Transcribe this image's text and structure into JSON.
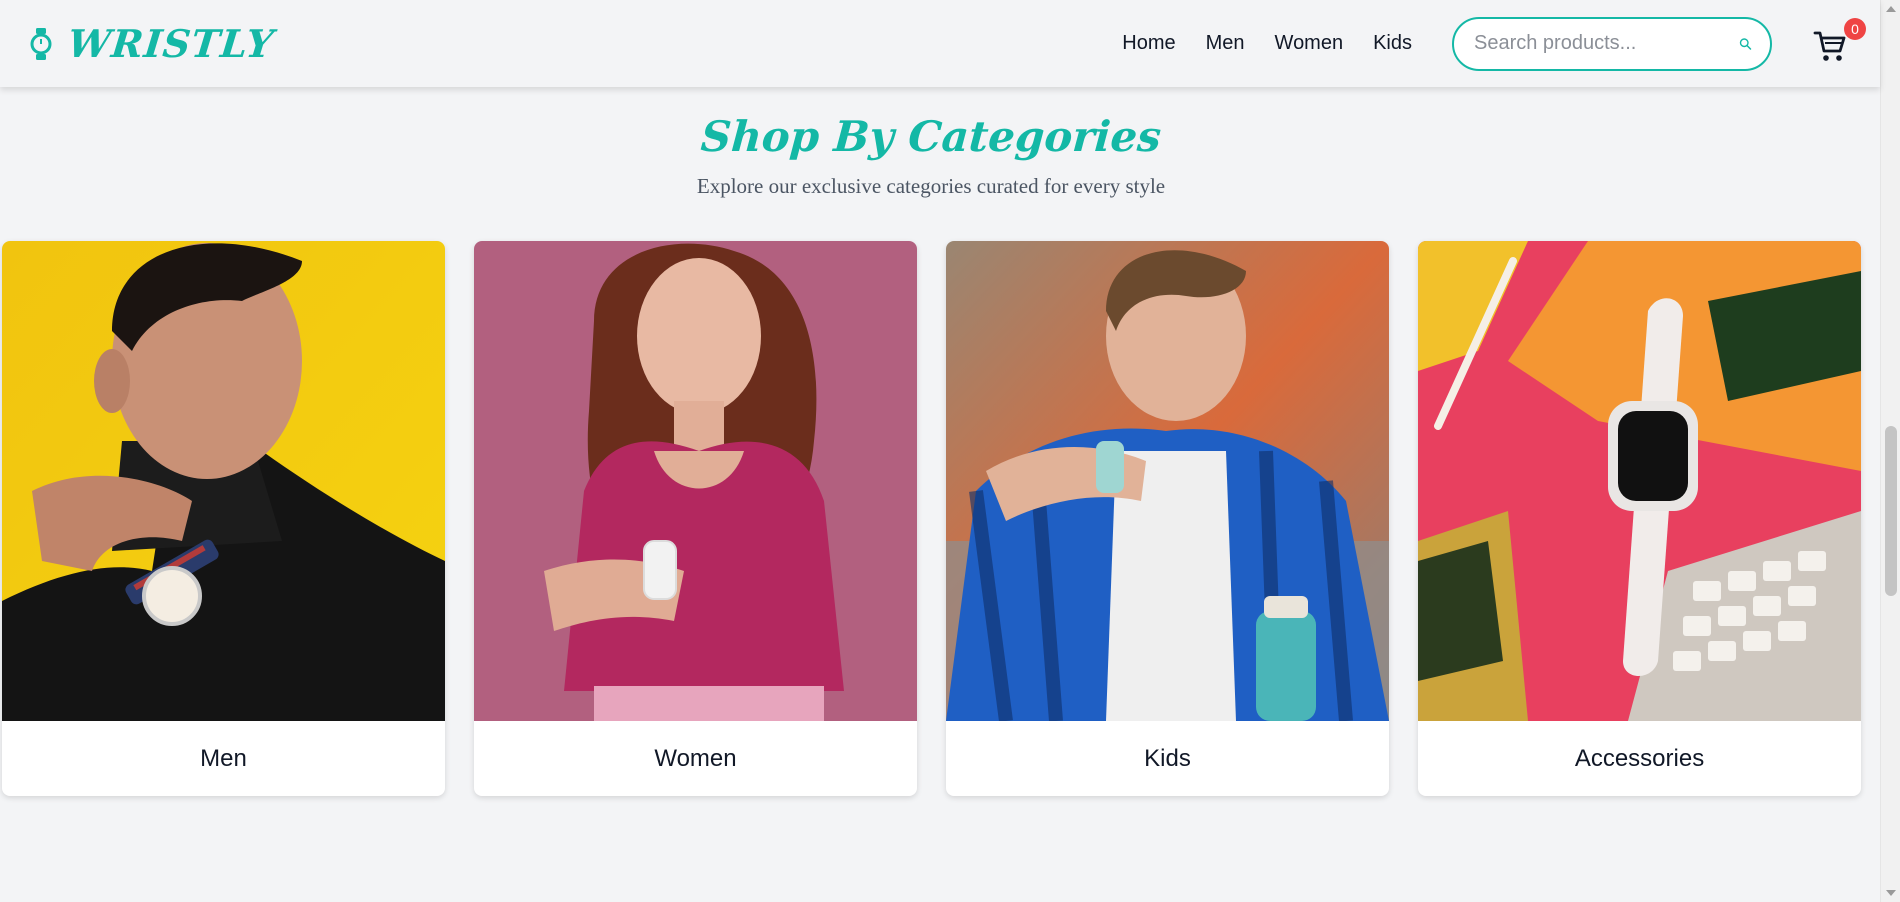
{
  "header": {
    "brand_name": "WRISTLY",
    "logo_icon": "watch-icon",
    "nav": [
      "Home",
      "Men",
      "Women",
      "Kids"
    ],
    "search_placeholder": "Search products...",
    "cart_count": "0"
  },
  "section": {
    "title": "Shop By Categories",
    "subtitle": "Explore our exclusive categories curated for every style"
  },
  "categories": [
    {
      "label": "Men",
      "image": "man-with-wristwatch-on-yellow"
    },
    {
      "label": "Women",
      "image": "woman-checking-smartwatch-on-pink"
    },
    {
      "label": "Kids",
      "image": "boy-checking-smartwatch-outdoors"
    },
    {
      "label": "Accessories",
      "image": "smartwatch-with-notebooks-and-keyboard"
    }
  ],
  "colors": {
    "brand": "#14b8a6",
    "badge": "#ef4444",
    "background": "#f3f4f6"
  }
}
